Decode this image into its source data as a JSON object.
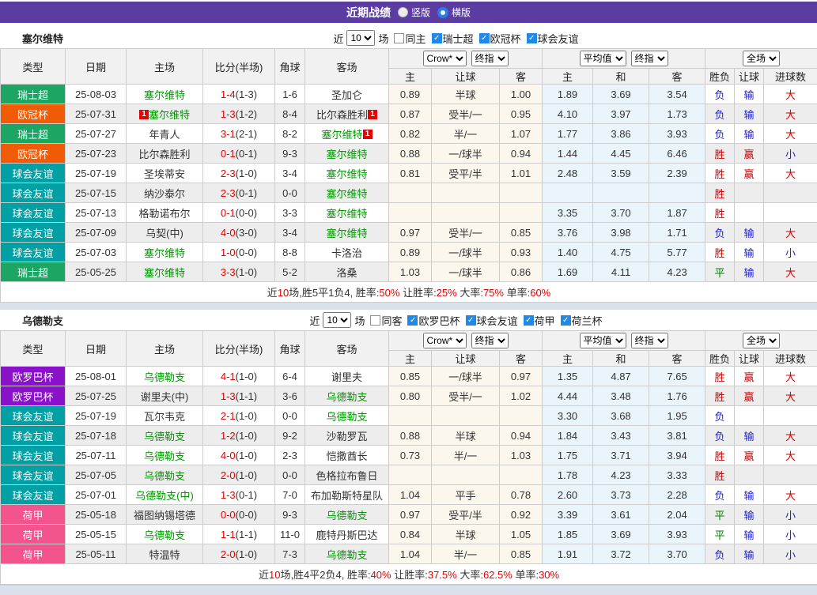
{
  "title_bar": {
    "title": "近期战绩",
    "vertical_label": "竖版",
    "horizontal_label": "横版"
  },
  "league_colors": {
    "瑞士超": "#1da563",
    "欧冠杯": "#f25b05",
    "球会友谊": "#00a0a5",
    "欧罗巴杯": "#8a10c9",
    "荷甲": "#f4548e"
  },
  "result_colors": {
    "胜": "r",
    "负": "b",
    "平": "g",
    "赢": "r",
    "输": "b",
    "大": "r",
    "小": "b"
  },
  "columns": {
    "type": "类型",
    "date": "日期",
    "home": "主场",
    "score": "比分(半场)",
    "corner": "角球",
    "away": "客场",
    "sub": [
      "主",
      "让球",
      "客",
      "主",
      "和",
      "客",
      "胜负",
      "让球",
      "进球数"
    ]
  },
  "sections": [
    {
      "team": "塞尔维特",
      "filter": {
        "near_label": "近",
        "count": "10",
        "games_label": "场",
        "same_label": "同主",
        "same_checked": false,
        "leagues": [
          "瑞士超",
          "欧冠杯",
          "球会友谊"
        ]
      },
      "selects": {
        "book": "Crow*",
        "book_time": "终指",
        "avg": "平均值",
        "avg_time": "终指",
        "scope": "全场"
      },
      "rows": [
        {
          "league": "瑞士超",
          "date": "25-08-03",
          "home": {
            "name": "塞尔维特",
            "green": true
          },
          "score": "1-4",
          "half": "(1-3)",
          "corner": "1-6",
          "away": {
            "name": "圣加仑"
          },
          "odds": [
            "0.89",
            "半球",
            "1.00"
          ],
          "avg": [
            "1.89",
            "3.69",
            "3.54"
          ],
          "result": [
            "负",
            "输",
            "大"
          ]
        },
        {
          "league": "欧冠杯",
          "date": "25-07-31",
          "home": {
            "name": "塞尔维特",
            "green": true,
            "badge_pre": "1"
          },
          "score": "1-3",
          "half": "(1-2)",
          "corner": "8-4",
          "away": {
            "name": "比尔森胜利",
            "badge_post": "1"
          },
          "odds": [
            "0.87",
            "受半/一",
            "0.95"
          ],
          "avg": [
            "4.10",
            "3.97",
            "1.73"
          ],
          "result": [
            "负",
            "输",
            "大"
          ]
        },
        {
          "league": "瑞士超",
          "date": "25-07-27",
          "home": {
            "name": "年青人"
          },
          "score": "3-1",
          "half": "(2-1)",
          "corner": "8-2",
          "away": {
            "name": "塞尔维特",
            "green": true,
            "badge_post": "1"
          },
          "odds": [
            "0.82",
            "半/一",
            "1.07"
          ],
          "avg": [
            "1.77",
            "3.86",
            "3.93"
          ],
          "result": [
            "负",
            "输",
            "大"
          ]
        },
        {
          "league": "欧冠杯",
          "date": "25-07-23",
          "home": {
            "name": "比尔森胜利"
          },
          "score": "0-1",
          "half": "(0-1)",
          "corner": "9-3",
          "away": {
            "name": "塞尔维特",
            "green": true
          },
          "odds": [
            "0.88",
            "一/球半",
            "0.94"
          ],
          "avg": [
            "1.44",
            "4.45",
            "6.46"
          ],
          "result": [
            "胜",
            "赢",
            "小"
          ]
        },
        {
          "league": "球会友谊",
          "date": "25-07-19",
          "home": {
            "name": "圣埃蒂安"
          },
          "score": "2-3",
          "half": "(1-0)",
          "corner": "3-4",
          "away": {
            "name": "塞尔维特",
            "green": true
          },
          "odds": [
            "0.81",
            "受平/半",
            "1.01"
          ],
          "avg": [
            "2.48",
            "3.59",
            "2.39"
          ],
          "result": [
            "胜",
            "赢",
            "大"
          ]
        },
        {
          "league": "球会友谊",
          "date": "25-07-15",
          "home": {
            "name": "纳沙泰尔"
          },
          "score": "2-3",
          "half": "(0-1)",
          "corner": "0-0",
          "away": {
            "name": "塞尔维特",
            "green": true
          },
          "odds": [
            "",
            "",
            ""
          ],
          "avg": [
            "",
            "",
            ""
          ],
          "result": [
            "胜",
            "",
            ""
          ]
        },
        {
          "league": "球会友谊",
          "date": "25-07-13",
          "home": {
            "name": "格勒诺布尔"
          },
          "score": "0-1",
          "half": "(0-0)",
          "corner": "3-3",
          "away": {
            "name": "塞尔维特",
            "green": true
          },
          "odds": [
            "",
            "",
            ""
          ],
          "avg": [
            "3.35",
            "3.70",
            "1.87"
          ],
          "result": [
            "胜",
            "",
            ""
          ]
        },
        {
          "league": "球会友谊",
          "date": "25-07-09",
          "home": {
            "name": "乌契(中)"
          },
          "score": "4-0",
          "half": "(3-0)",
          "corner": "3-4",
          "away": {
            "name": "塞尔维特",
            "green": true
          },
          "odds": [
            "0.97",
            "受半/一",
            "0.85"
          ],
          "avg": [
            "3.76",
            "3.98",
            "1.71"
          ],
          "result": [
            "负",
            "输",
            "大"
          ]
        },
        {
          "league": "球会友谊",
          "date": "25-07-03",
          "home": {
            "name": "塞尔维特",
            "green": true
          },
          "score": "1-0",
          "half": "(0-0)",
          "corner": "8-8",
          "away": {
            "name": "卡洛治"
          },
          "odds": [
            "0.89",
            "一/球半",
            "0.93"
          ],
          "avg": [
            "1.40",
            "4.75",
            "5.77"
          ],
          "result": [
            "胜",
            "输",
            "小"
          ]
        },
        {
          "league": "瑞士超",
          "date": "25-05-25",
          "home": {
            "name": "塞尔维特",
            "green": true
          },
          "score": "3-3",
          "half": "(1-0)",
          "corner": "5-2",
          "away": {
            "name": "洛桑"
          },
          "odds": [
            "1.03",
            "一/球半",
            "0.86"
          ],
          "avg": [
            "1.69",
            "4.11",
            "4.23"
          ],
          "result": [
            "平",
            "输",
            "大"
          ]
        }
      ],
      "summary": [
        {
          "t": "近",
          "red": false
        },
        {
          "t": "10",
          "red": true
        },
        {
          "t": "场,胜5平1负4, 胜率:",
          "red": false
        },
        {
          "t": "50%",
          "red": true
        },
        {
          "t": " 让胜率:",
          "red": false
        },
        {
          "t": "25%",
          "red": true
        },
        {
          "t": " 大率:",
          "red": false
        },
        {
          "t": "75%",
          "red": true
        },
        {
          "t": " 单率:",
          "red": false
        },
        {
          "t": "60%",
          "red": true
        }
      ]
    },
    {
      "team": "乌德勒支",
      "filter": {
        "near_label": "近",
        "count": "10",
        "games_label": "场",
        "same_label": "同客",
        "same_checked": false,
        "leagues": [
          "欧罗巴杯",
          "球会友谊",
          "荷甲",
          "荷兰杯"
        ]
      },
      "selects": {
        "book": "Crow*",
        "book_time": "终指",
        "avg": "平均值",
        "avg_time": "终指",
        "scope": "全场"
      },
      "rows": [
        {
          "league": "欧罗巴杯",
          "date": "25-08-01",
          "home": {
            "name": "乌德勒支",
            "green": true
          },
          "score": "4-1",
          "half": "(1-0)",
          "corner": "6-4",
          "away": {
            "name": "谢里夫"
          },
          "odds": [
            "0.85",
            "一/球半",
            "0.97"
          ],
          "avg": [
            "1.35",
            "4.87",
            "7.65"
          ],
          "result": [
            "胜",
            "赢",
            "大"
          ]
        },
        {
          "league": "欧罗巴杯",
          "date": "25-07-25",
          "home": {
            "name": "谢里夫(中)"
          },
          "score": "1-3",
          "half": "(1-1)",
          "corner": "3-6",
          "away": {
            "name": "乌德勒支",
            "green": true
          },
          "odds": [
            "0.80",
            "受半/一",
            "1.02"
          ],
          "avg": [
            "4.44",
            "3.48",
            "1.76"
          ],
          "result": [
            "胜",
            "赢",
            "大"
          ]
        },
        {
          "league": "球会友谊",
          "date": "25-07-19",
          "home": {
            "name": "瓦尔韦克"
          },
          "score": "2-1",
          "half": "(1-0)",
          "corner": "0-0",
          "away": {
            "name": "乌德勒支",
            "green": true
          },
          "odds": [
            "",
            "",
            ""
          ],
          "avg": [
            "3.30",
            "3.68",
            "1.95"
          ],
          "result": [
            "负",
            "",
            ""
          ]
        },
        {
          "league": "球会友谊",
          "date": "25-07-18",
          "home": {
            "name": "乌德勒支",
            "green": true
          },
          "score": "1-2",
          "half": "(1-0)",
          "corner": "9-2",
          "away": {
            "name": "沙勒罗瓦"
          },
          "odds": [
            "0.88",
            "半球",
            "0.94"
          ],
          "avg": [
            "1.84",
            "3.43",
            "3.81"
          ],
          "result": [
            "负",
            "输",
            "大"
          ]
        },
        {
          "league": "球会友谊",
          "date": "25-07-11",
          "home": {
            "name": "乌德勒支",
            "green": true
          },
          "score": "4-0",
          "half": "(1-0)",
          "corner": "2-3",
          "away": {
            "name": "恺撒酋长"
          },
          "odds": [
            "0.73",
            "半/一",
            "1.03"
          ],
          "avg": [
            "1.75",
            "3.71",
            "3.94"
          ],
          "result": [
            "胜",
            "赢",
            "大"
          ]
        },
        {
          "league": "球会友谊",
          "date": "25-07-05",
          "home": {
            "name": "乌德勒支",
            "green": true
          },
          "score": "2-0",
          "half": "(1-0)",
          "corner": "0-0",
          "away": {
            "name": "色格拉布鲁日"
          },
          "odds": [
            "",
            "",
            ""
          ],
          "avg": [
            "1.78",
            "4.23",
            "3.33"
          ],
          "result": [
            "胜",
            "",
            ""
          ]
        },
        {
          "league": "球会友谊",
          "date": "25-07-01",
          "home": {
            "name": "乌德勒支(中)",
            "green": true
          },
          "score": "1-3",
          "half": "(0-1)",
          "corner": "7-0",
          "away": {
            "name": "布加勒斯特星队"
          },
          "odds": [
            "1.04",
            "平手",
            "0.78"
          ],
          "avg": [
            "2.60",
            "3.73",
            "2.28"
          ],
          "result": [
            "负",
            "输",
            "大"
          ]
        },
        {
          "league": "荷甲",
          "date": "25-05-18",
          "home": {
            "name": "福图纳锡塔德"
          },
          "score": "0-0",
          "half": "(0-0)",
          "corner": "9-3",
          "away": {
            "name": "乌德勒支",
            "green": true
          },
          "odds": [
            "0.97",
            "受平/半",
            "0.92"
          ],
          "avg": [
            "3.39",
            "3.61",
            "2.04"
          ],
          "result": [
            "平",
            "输",
            "小"
          ]
        },
        {
          "league": "荷甲",
          "date": "25-05-15",
          "home": {
            "name": "乌德勒支",
            "green": true
          },
          "score": "1-1",
          "half": "(1-1)",
          "corner": "11-0",
          "away": {
            "name": "鹿特丹斯巴达"
          },
          "odds": [
            "0.84",
            "半球",
            "1.05"
          ],
          "avg": [
            "1.85",
            "3.69",
            "3.93"
          ],
          "result": [
            "平",
            "输",
            "小"
          ]
        },
        {
          "league": "荷甲",
          "date": "25-05-11",
          "home": {
            "name": "特温特"
          },
          "score": "2-0",
          "half": "(1-0)",
          "corner": "7-3",
          "away": {
            "name": "乌德勒支",
            "green": true
          },
          "odds": [
            "1.04",
            "半/一",
            "0.85"
          ],
          "avg": [
            "1.91",
            "3.72",
            "3.70"
          ],
          "result": [
            "负",
            "输",
            "小"
          ]
        }
      ],
      "summary": [
        {
          "t": "近",
          "red": false
        },
        {
          "t": "10",
          "red": true
        },
        {
          "t": "场,胜4平2负4, 胜率:",
          "red": false
        },
        {
          "t": "40%",
          "red": true
        },
        {
          "t": " 让胜率:",
          "red": false
        },
        {
          "t": "37.5%",
          "red": true
        },
        {
          "t": " 大率:",
          "red": false
        },
        {
          "t": "62.5%",
          "red": true
        },
        {
          "t": " 单率:",
          "red": false
        },
        {
          "t": "30%",
          "red": true
        }
      ]
    }
  ]
}
